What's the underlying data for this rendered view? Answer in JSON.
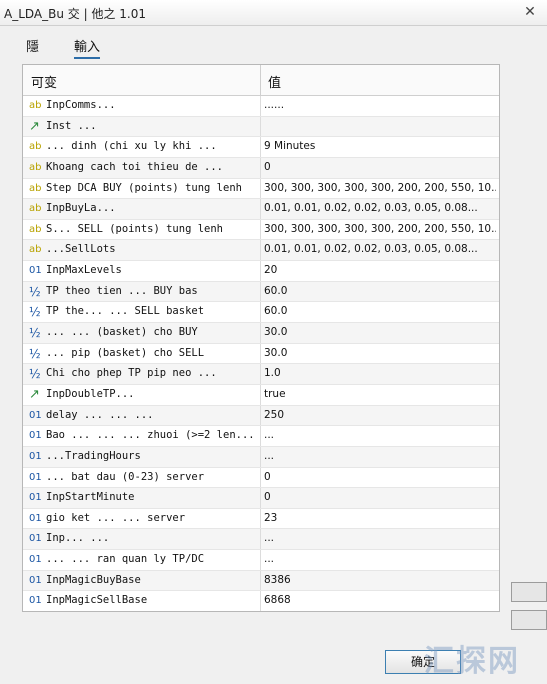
{
  "window": {
    "title": "A_LDA_Bu 交 | 他之 1.01",
    "close_glyph": "✕"
  },
  "tabs": [
    {
      "label": "隱"
    },
    {
      "label": "輸入"
    }
  ],
  "table": {
    "headers": {
      "variable": "可变",
      "value": "值"
    },
    "rows": [
      {
        "icon": "ab",
        "type": "string",
        "name": "InpComms...",
        "value": "......"
      },
      {
        "icon": "↗",
        "type": "bool",
        "name": "Inst ...",
        "value": ""
      },
      {
        "icon": "ab",
        "type": "string",
        "name": "... dinh (chi xu ly khi ...",
        "value": "9 Minutes"
      },
      {
        "icon": "ab",
        "type": "string",
        "name": "Khoang cach toi thieu de ...",
        "value": "0"
      },
      {
        "icon": "ab",
        "type": "string",
        "name": "Step DCA BUY (points) tung lenh",
        "value": "300, 300, 300, 300, 300, 200, 200, 550, 10..."
      },
      {
        "icon": "ab",
        "type": "string",
        "name": "InpBuyLa...",
        "value": "0.01, 0.01, 0.02, 0.02, 0.03, 0.05, 0.08..."
      },
      {
        "icon": "ab",
        "type": "string",
        "name": "S... SELL (points) tung lenh",
        "value": "300, 300, 300, 300, 300, 200, 200, 550, 10..."
      },
      {
        "icon": "ab",
        "type": "string",
        "name": "...SellLots",
        "value": "0.01, 0.01, 0.02, 0.02, 0.03, 0.05, 0.08..."
      },
      {
        "icon": "01",
        "type": "int",
        "name": "InpMaxLevels",
        "value": "20"
      },
      {
        "icon": "½",
        "type": "double",
        "name": "TP theo tien ... BUY bas",
        "value": "60.0"
      },
      {
        "icon": "½",
        "type": "double",
        "name": "TP the... ... SELL basket",
        "value": "60.0"
      },
      {
        "icon": "½",
        "type": "double",
        "name": "... ... (basket) cho BUY",
        "value": "30.0"
      },
      {
        "icon": "½",
        "type": "double",
        "name": "... pip (basket) cho SELL",
        "value": "30.0"
      },
      {
        "icon": "½",
        "type": "double",
        "name": "Chi cho phep TP pip neo ...",
        "value": "1.0"
      },
      {
        "icon": "↗",
        "type": "bool",
        "name": "InpDoubleTP...",
        "value": "true"
      },
      {
        "icon": "01",
        "type": "int",
        "name": "delay ... ... ...",
        "value": "250"
      },
      {
        "icon": "01",
        "type": "int",
        "name": "Bao ... ... ... zhuoi (>=2 len...",
        "value": "..."
      },
      {
        "icon": "01",
        "type": "int",
        "name": "...TradingHours",
        "value": "..."
      },
      {
        "icon": "01",
        "type": "int",
        "name": "... bat dau (0-23) server",
        "value": "0"
      },
      {
        "icon": "01",
        "type": "int",
        "name": "InpStartMinute",
        "value": "0"
      },
      {
        "icon": "01",
        "type": "int",
        "name": "gio ket ... ... server",
        "value": "23"
      },
      {
        "icon": "01",
        "type": "int",
        "name": "Inp... ...",
        "value": "..."
      },
      {
        "icon": "01",
        "type": "int",
        "name": "... ... ran quan ly TP/DC",
        "value": "..."
      },
      {
        "icon": "01",
        "type": "int",
        "name": "InpMagicBuyBase",
        "value": "8386"
      },
      {
        "icon": "01",
        "type": "int",
        "name": "InpMagicSellBase",
        "value": "6868"
      }
    ]
  },
  "buttons": {
    "ok_label": "确定"
  },
  "watermark": {
    "text": "汇探网"
  }
}
